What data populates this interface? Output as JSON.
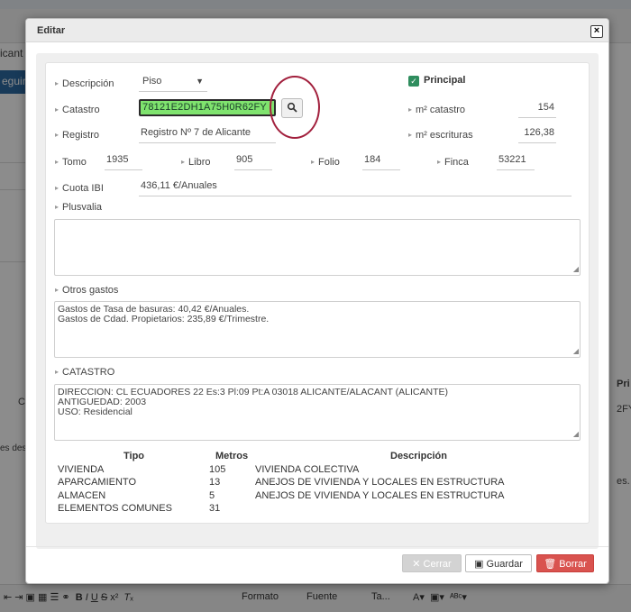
{
  "background": {
    "text_top": "icant",
    "button_label": "eguir",
    "side_label_1": "C",
    "side_label_2": "es des",
    "side_right_1": "Pri",
    "side_right_2": "2FY",
    "side_right_3": "es.",
    "editor_format": "Formato",
    "editor_font": "Fuente",
    "editor_size": "Ta..."
  },
  "modal": {
    "title": "Editar",
    "close": "×"
  },
  "form": {
    "descripcion": {
      "label": "Descripción",
      "value": "Piso"
    },
    "principal": {
      "label": "Principal",
      "checked": true
    },
    "catastro": {
      "label": "Catastro",
      "value": "78121E2DH1A75H0R62FY"
    },
    "m2_catastro": {
      "label": "m² catastro",
      "value": "154"
    },
    "registro": {
      "label": "Registro",
      "value": "Registro Nº 7 de Alicante"
    },
    "m2_escrituras": {
      "label": "m² escrituras",
      "value": "126,38"
    },
    "tomo": {
      "label": "Tomo",
      "value": "1935"
    },
    "libro": {
      "label": "Libro",
      "value": "905"
    },
    "folio": {
      "label": "Folio",
      "value": "184"
    },
    "finca": {
      "label": "Finca",
      "value": "53221"
    },
    "cuota_ibi": {
      "label": "Cuota IBI",
      "value": "436,11 €/Anuales"
    },
    "plusvalia": {
      "label": "Plusvalia",
      "value": ""
    },
    "otros_gastos": {
      "label": "Otros gastos",
      "line1": "Gastos de Tasa de basuras: 40,42 €/Anuales.",
      "line2": "Gastos de Cdad. Propietarios: 235,89 €/Trimestre."
    },
    "catastro_info": {
      "label": "CATASTRO",
      "line1": "DIRECCION: CL ECUADORES 22 Es:3 Pl:09 Pt:A 03018 ALICANTE/ALACANT (ALICANTE)",
      "line2": "ANTIGUEDAD: 2003",
      "line3": "USO: Residencial"
    }
  },
  "table": {
    "headers": {
      "tipo": "Tipo",
      "metros": "Metros",
      "descripcion": "Descripción"
    },
    "rows": [
      {
        "tipo": "VIVIENDA",
        "metros": "105",
        "descripcion": "VIVIENDA COLECTIVA"
      },
      {
        "tipo": "APARCAMIENTO",
        "metros": "13",
        "descripcion": "ANEJOS DE VIVIENDA Y LOCALES EN ESTRUCTURA"
      },
      {
        "tipo": "ALMACEN",
        "metros": "5",
        "descripcion": "ANEJOS DE VIVIENDA Y LOCALES EN ESTRUCTURA"
      },
      {
        "tipo": "ELEMENTOS COMUNES",
        "metros": "31",
        "descripcion": ""
      }
    ]
  },
  "footer": {
    "cerrar": "Cerrar",
    "guardar": "Guardar",
    "borrar": "Borrar"
  },
  "colors": {
    "catastro_highlight": "#7fe36e",
    "annotation_circle": "#a2203d",
    "checkbox": "#2f8d5e",
    "danger": "#d9534f"
  }
}
